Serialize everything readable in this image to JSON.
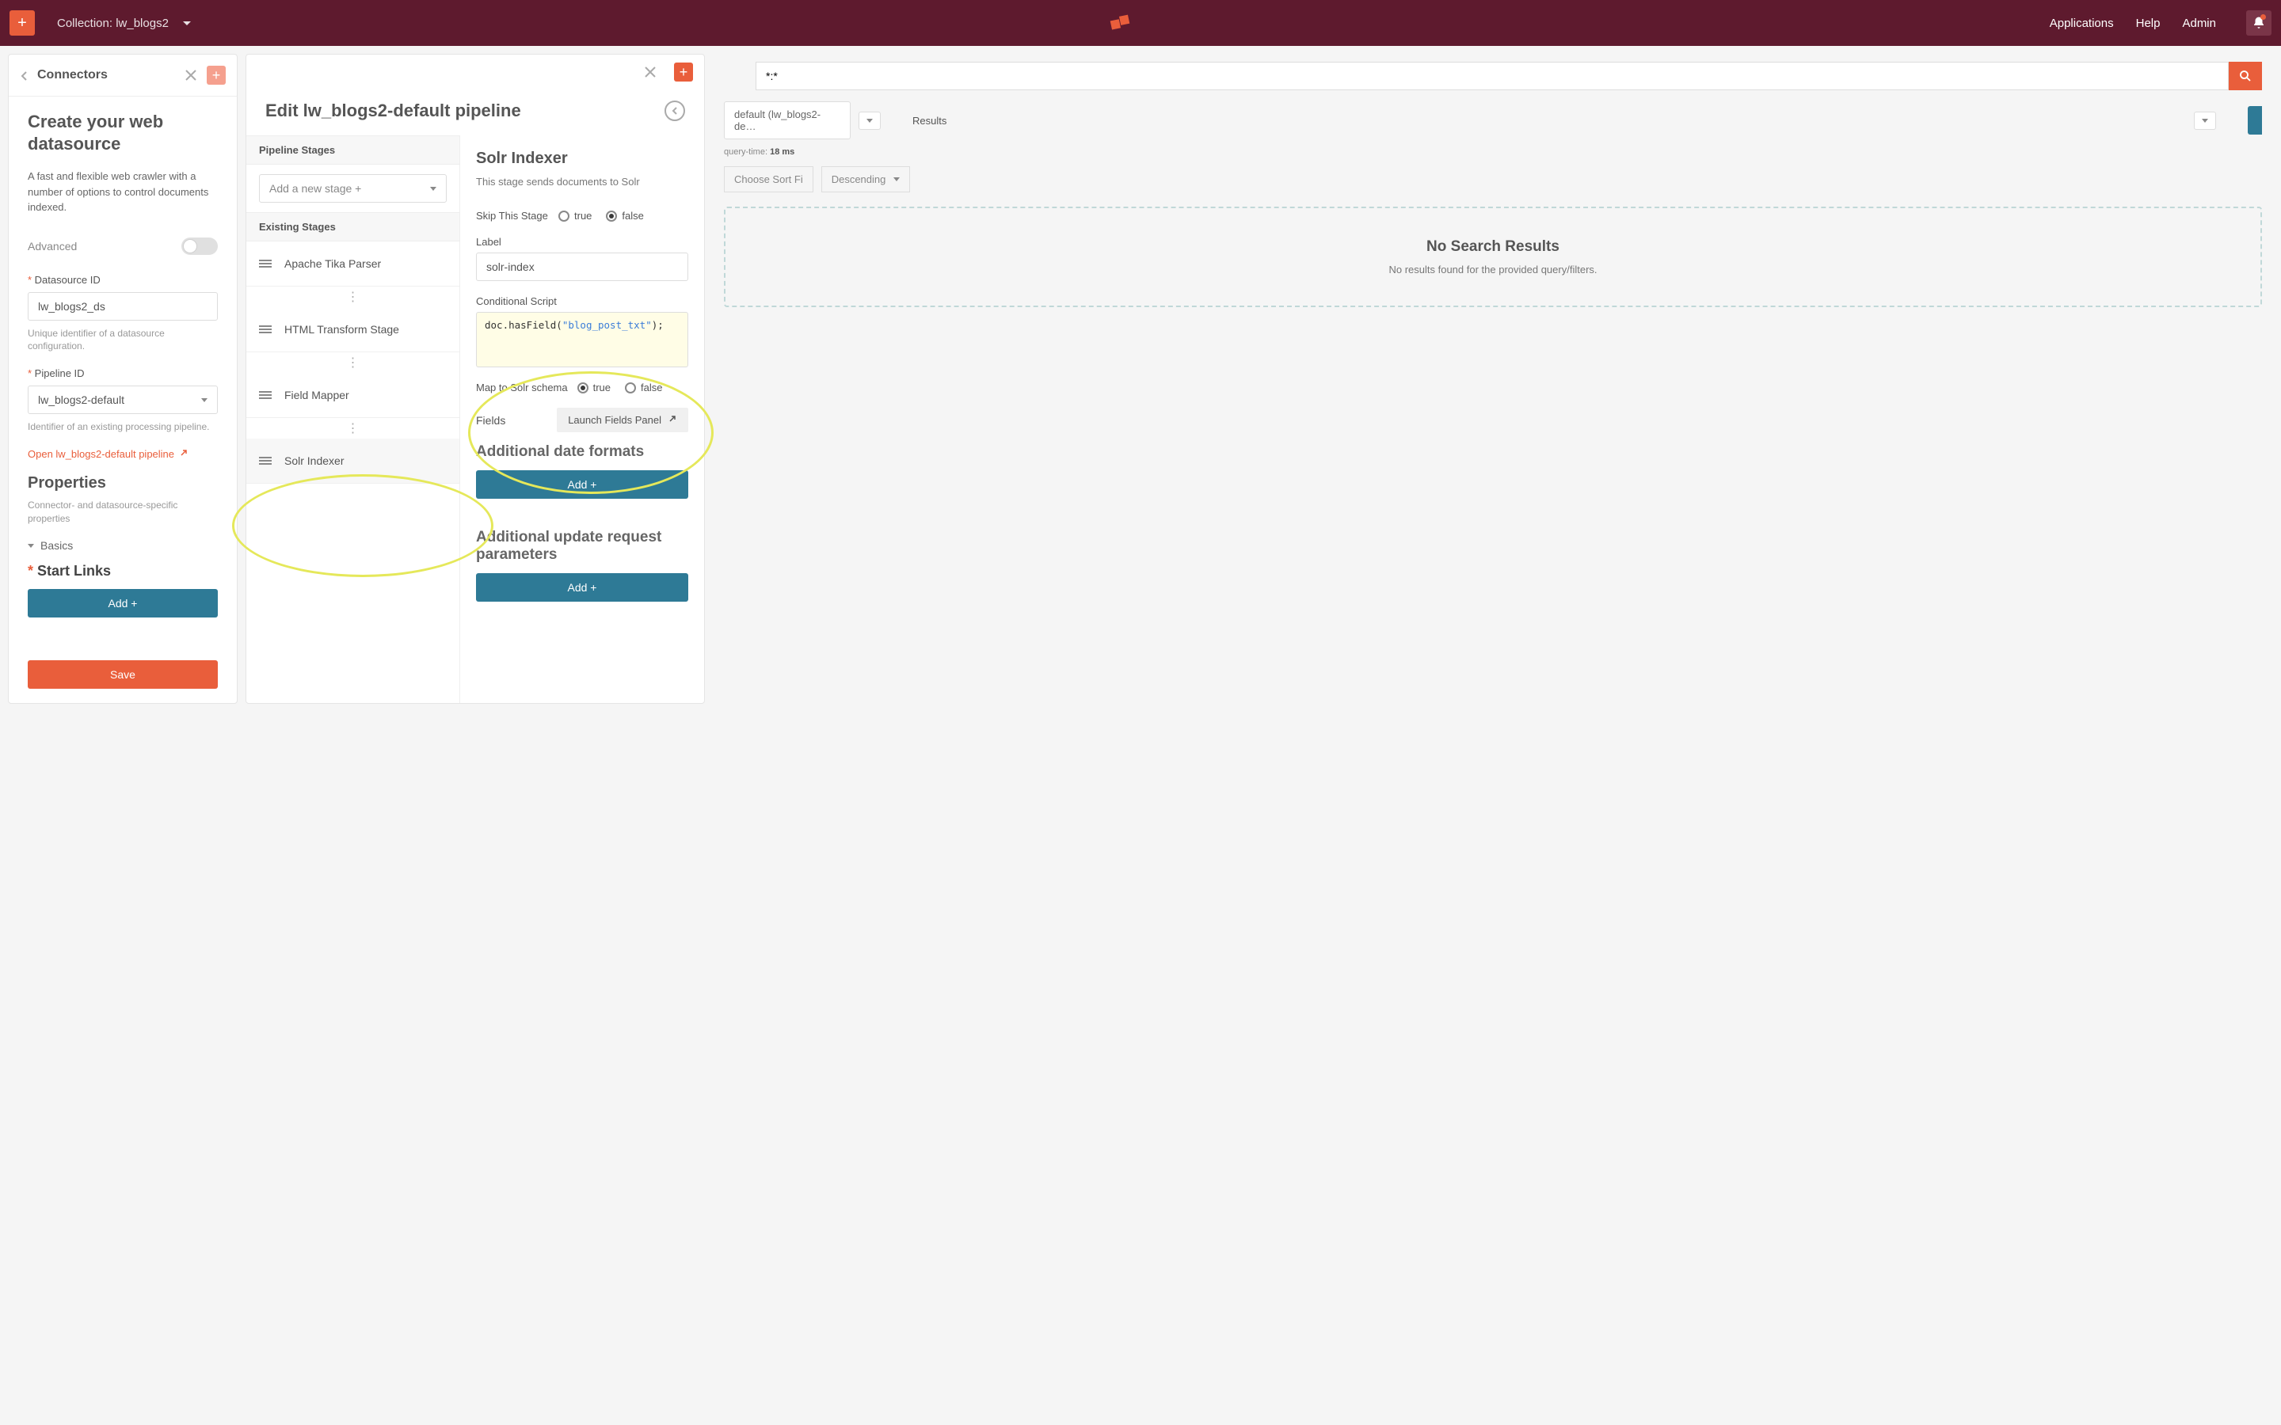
{
  "colors": {
    "accent": "#e95e3b",
    "header": "#5e1a2e",
    "teal": "#2e7a96"
  },
  "header": {
    "collection_label": "Collection: lw_blogs2",
    "nav": {
      "applications": "Applications",
      "help": "Help",
      "admin": "Admin"
    }
  },
  "panel1": {
    "title": "Connectors",
    "heading": "Create your web datasource",
    "desc": "A fast and flexible web crawler with a number of options to control documents indexed.",
    "advanced_label": "Advanced",
    "datasource_id": {
      "label": "Datasource ID",
      "value": "lw_blogs2_ds",
      "hint": "Unique identifier of a datasource configuration."
    },
    "pipeline_id": {
      "label": "Pipeline ID",
      "value": "lw_blogs2-default",
      "hint": "Identifier of an existing processing pipeline."
    },
    "open_pipeline_link": "Open lw_blogs2-default pipeline",
    "properties": {
      "title": "Properties",
      "desc": "Connector- and datasource-specific properties"
    },
    "basics_label": "Basics",
    "start_links_label": "Start Links",
    "add_btn": "Add +",
    "save_btn": "Save"
  },
  "panel2": {
    "title": "Edit lw_blogs2-default pipeline",
    "stages_label": "Pipeline Stages",
    "add_stage_placeholder": "Add a new stage +",
    "existing_label": "Existing Stages",
    "stages": [
      "Apache Tika Parser",
      "HTML Transform Stage",
      "Field Mapper",
      "Solr Indexer"
    ],
    "detail": {
      "title": "Solr Indexer",
      "sub": "This stage sends documents to Solr",
      "skip_label": "Skip This Stage",
      "true_label": "true",
      "false_label": "false",
      "label_label": "Label",
      "label_value": "solr-index",
      "cond_label": "Conditional Script",
      "cond_code_pre": "doc.hasField(",
      "cond_code_str": "\"blog_post_txt\"",
      "cond_code_post": ");",
      "map_label": "Map to Solr schema",
      "fields_label": "Fields",
      "launch_fields": "Launch Fields Panel",
      "sec_date": "Additional date formats",
      "sec_update": "Additional update request parameters",
      "add_btn": "Add +"
    }
  },
  "panel3": {
    "search_placeholder": "*:*",
    "default_dd": "default (lw_blogs2-de…",
    "results_dd": "Results",
    "query_time_label": "query-time:",
    "query_time_value": "18 ms",
    "sort_placeholder": "Choose Sort Fi",
    "order": "Descending",
    "nr_title": "No Search Results",
    "nr_sub": "No results found for the provided query/filters."
  }
}
